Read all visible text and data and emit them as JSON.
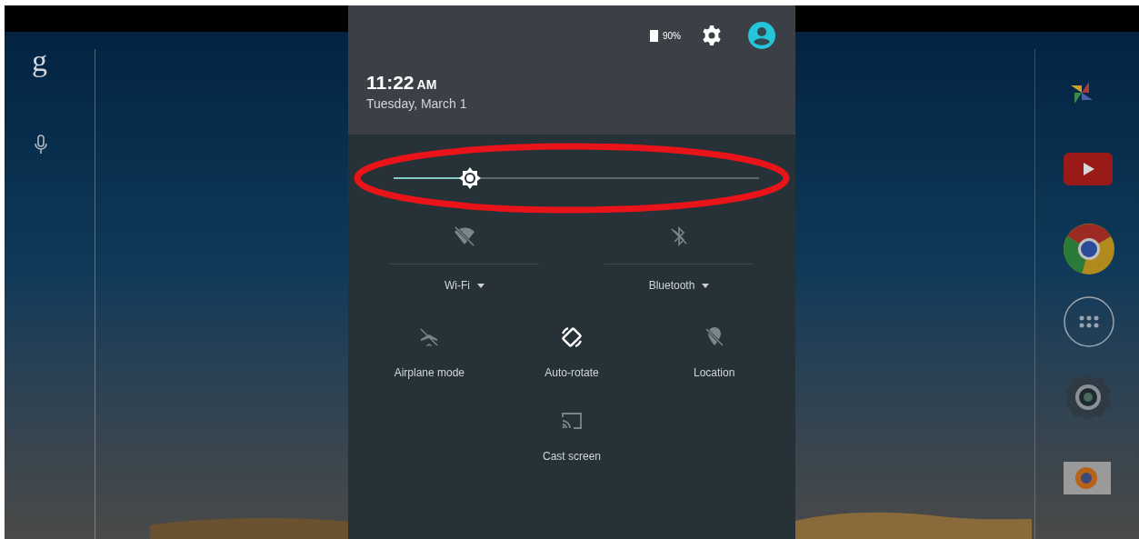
{
  "launcher": {
    "search_glyph": "g"
  },
  "quick_settings": {
    "battery": "90%",
    "time": "11:22",
    "time_suffix": "AM",
    "date": "Tuesday, March 1",
    "brightness": {
      "level": 0.21
    },
    "big_tiles": [
      {
        "kind": "wifi",
        "label": "Wi-Fi",
        "on": false
      },
      {
        "kind": "bluetooth",
        "label": "Bluetooth",
        "on": false
      }
    ],
    "tiles": [
      {
        "kind": "airplane",
        "label": "Airplane mode",
        "on": false
      },
      {
        "kind": "rotate",
        "label": "Auto-rotate",
        "on": true
      },
      {
        "kind": "location",
        "label": "Location",
        "on": false
      },
      {
        "kind": "cast",
        "label": "Cast screen",
        "on": false
      }
    ]
  }
}
